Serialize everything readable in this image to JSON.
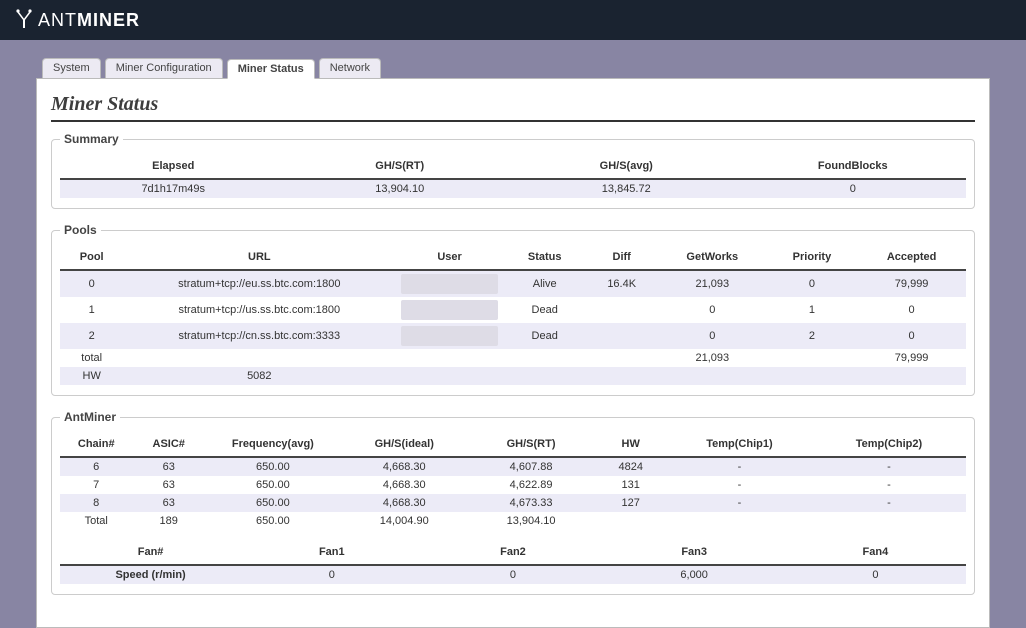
{
  "brand": {
    "left": "ANT",
    "right": "MINER"
  },
  "tabs": [
    "System",
    "Miner Configuration",
    "Miner Status",
    "Network"
  ],
  "active_tab_index": 2,
  "page_title": "Miner Status",
  "summary": {
    "legend": "Summary",
    "headers": [
      "Elapsed",
      "GH/S(RT)",
      "GH/S(avg)",
      "FoundBlocks"
    ],
    "row": [
      "7d1h17m49s",
      "13,904.10",
      "13,845.72",
      "0"
    ]
  },
  "pools": {
    "legend": "Pools",
    "headers": [
      "Pool",
      "URL",
      "User",
      "Status",
      "Diff",
      "GetWorks",
      "Priority",
      "Accepted"
    ],
    "rows": [
      [
        "0",
        "stratum+tcp://eu.ss.btc.com:1800",
        "",
        "Alive",
        "16.4K",
        "21,093",
        "0",
        "79,999"
      ],
      [
        "1",
        "stratum+tcp://us.ss.btc.com:1800",
        "",
        "Dead",
        "",
        "0",
        "1",
        "0"
      ],
      [
        "2",
        "stratum+tcp://cn.ss.btc.com:3333",
        "",
        "Dead",
        "",
        "0",
        "2",
        "0"
      ],
      [
        "total",
        "",
        "",
        "",
        "",
        "21,093",
        "",
        "79,999"
      ],
      [
        "HW",
        "5082",
        "",
        "",
        "",
        "",
        "",
        ""
      ]
    ]
  },
  "antminer": {
    "legend": "AntMiner",
    "chain_headers": [
      "Chain#",
      "ASIC#",
      "Frequency(avg)",
      "GH/S(ideal)",
      "GH/S(RT)",
      "HW",
      "Temp(Chip1)",
      "Temp(Chip2)"
    ],
    "chain_rows": [
      [
        "6",
        "63",
        "650.00",
        "4,668.30",
        "4,607.88",
        "4824",
        "-",
        "-"
      ],
      [
        "7",
        "63",
        "650.00",
        "4,668.30",
        "4,622.89",
        "131",
        "-",
        "-"
      ],
      [
        "8",
        "63",
        "650.00",
        "4,668.30",
        "4,673.33",
        "127",
        "-",
        "-"
      ],
      [
        "Total",
        "189",
        "650.00",
        "14,004.90",
        "13,904.10",
        "",
        "",
        ""
      ]
    ],
    "fan_headers": [
      "Fan#",
      "Fan1",
      "Fan2",
      "Fan3",
      "Fan4"
    ],
    "fan_row": [
      "Speed (r/min)",
      "0",
      "0",
      "6,000",
      "0"
    ]
  }
}
